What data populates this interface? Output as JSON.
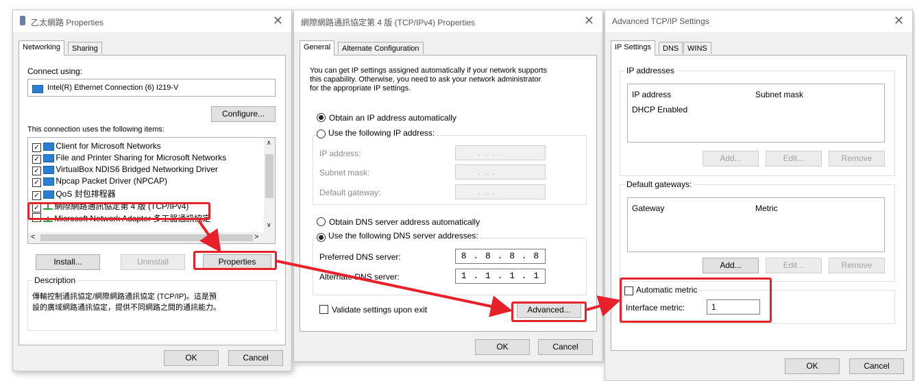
{
  "win1": {
    "title": "乙太網路 Properties",
    "tabs": [
      "Networking",
      "Sharing"
    ],
    "connect_using_label": "Connect using:",
    "adapter_name": "Intel(R) Ethernet Connection (6) I219-V",
    "configure_button": "Configure...",
    "items_label": "This connection uses the following items:",
    "items": [
      {
        "label": "Client for Microsoft Networks",
        "checked": true
      },
      {
        "label": "File and Printer Sharing for Microsoft Networks",
        "checked": true
      },
      {
        "label": "VirtualBox NDIS6 Bridged Networking Driver",
        "checked": true
      },
      {
        "label": "Npcap Packet Driver (NPCAP)",
        "checked": true
      },
      {
        "label": "QoS 封包排程器",
        "checked": true
      },
      {
        "label": "網際網路通訊協定第 4 版 (TCP/IPv4)",
        "checked": true
      },
      {
        "label": "Microsoft Network Adapter 多工器通訊協定",
        "checked": false
      }
    ],
    "install_button": "Install...",
    "uninstall_button": "Uninstall",
    "properties_button": "Properties",
    "description_label": "Description",
    "description_text_1": "傳輸控制通訊協定/網際網路通訊協定 (TCP/IP)。這是預",
    "description_text_2": "設的廣域網路通訊協定，提供不同網路之間的通訊能力。",
    "ok_button": "OK",
    "cancel_button": "Cancel"
  },
  "win2": {
    "title": "網際網路通訊協定第 4 版 (TCP/IPv4) Properties",
    "tabs": [
      "General",
      "Alternate Configuration"
    ],
    "intro_1": "You can get IP settings assigned automatically if your network supports",
    "intro_2": "this capability. Otherwise, you need to ask your network administrator",
    "intro_3": "for the appropriate IP settings.",
    "obtain_ip_auto": "Obtain an IP address automatically",
    "use_following_ip": "Use the following IP address:",
    "ip_address_label": "IP address:",
    "subnet_mask_label": "Subnet mask:",
    "default_gateway_label": "Default gateway:",
    "empty_ip": ".     .     .",
    "obtain_dns_auto": "Obtain DNS server address automatically",
    "use_following_dns": "Use the following DNS server addresses:",
    "preferred_dns_label": "Preferred DNS server:",
    "preferred_dns_value": "8 . 8 . 8 . 8",
    "alternate_dns_label": "Alternate DNS server:",
    "alternate_dns_value": "1 . 1 . 1 . 1",
    "validate_label": "Validate settings upon exit",
    "advanced_button": "Advanced...",
    "ok_button": "OK",
    "cancel_button": "Cancel"
  },
  "win3": {
    "title": "Advanced TCP/IP Settings",
    "tabs": [
      "IP Settings",
      "DNS",
      "WINS"
    ],
    "ip_addresses_label": "IP addresses",
    "col_ip_address": "IP address",
    "col_subnet_mask": "Subnet mask",
    "dhcp_enabled": "DHCP Enabled",
    "add_button": "Add...",
    "edit_button": "Edit...",
    "remove_button": "Remove",
    "default_gateways_label": "Default gateways:",
    "col_gateway": "Gateway",
    "col_metric": "Metric",
    "automatic_metric_label": "Automatic metric",
    "interface_metric_label": "Interface metric:",
    "interface_metric_value": "1",
    "ok_button": "OK",
    "cancel_button": "Cancel"
  },
  "colors": {
    "highlight_red": "#e8202a",
    "selection_blue": "#2a7fd4"
  }
}
